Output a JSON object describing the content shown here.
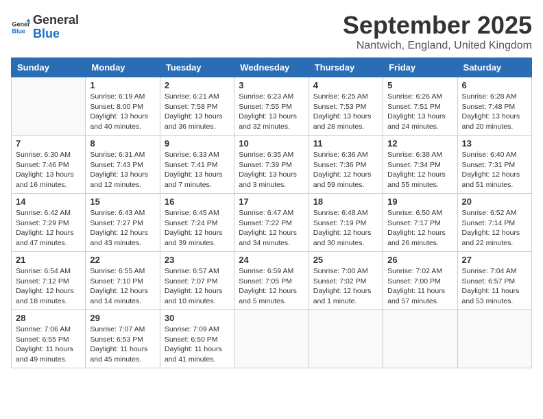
{
  "header": {
    "logo_general": "General",
    "logo_blue": "Blue",
    "month_title": "September 2025",
    "location": "Nantwich, England, United Kingdom"
  },
  "weekdays": [
    "Sunday",
    "Monday",
    "Tuesday",
    "Wednesday",
    "Thursday",
    "Friday",
    "Saturday"
  ],
  "weeks": [
    [
      {
        "day": "",
        "info": ""
      },
      {
        "day": "1",
        "info": "Sunrise: 6:19 AM\nSunset: 8:00 PM\nDaylight: 13 hours\nand 40 minutes."
      },
      {
        "day": "2",
        "info": "Sunrise: 6:21 AM\nSunset: 7:58 PM\nDaylight: 13 hours\nand 36 minutes."
      },
      {
        "day": "3",
        "info": "Sunrise: 6:23 AM\nSunset: 7:55 PM\nDaylight: 13 hours\nand 32 minutes."
      },
      {
        "day": "4",
        "info": "Sunrise: 6:25 AM\nSunset: 7:53 PM\nDaylight: 13 hours\nand 28 minutes."
      },
      {
        "day": "5",
        "info": "Sunrise: 6:26 AM\nSunset: 7:51 PM\nDaylight: 13 hours\nand 24 minutes."
      },
      {
        "day": "6",
        "info": "Sunrise: 6:28 AM\nSunset: 7:48 PM\nDaylight: 13 hours\nand 20 minutes."
      }
    ],
    [
      {
        "day": "7",
        "info": "Sunrise: 6:30 AM\nSunset: 7:46 PM\nDaylight: 13 hours\nand 16 minutes."
      },
      {
        "day": "8",
        "info": "Sunrise: 6:31 AM\nSunset: 7:43 PM\nDaylight: 13 hours\nand 12 minutes."
      },
      {
        "day": "9",
        "info": "Sunrise: 6:33 AM\nSunset: 7:41 PM\nDaylight: 13 hours\nand 7 minutes."
      },
      {
        "day": "10",
        "info": "Sunrise: 6:35 AM\nSunset: 7:39 PM\nDaylight: 13 hours\nand 3 minutes."
      },
      {
        "day": "11",
        "info": "Sunrise: 6:36 AM\nSunset: 7:36 PM\nDaylight: 12 hours\nand 59 minutes."
      },
      {
        "day": "12",
        "info": "Sunrise: 6:38 AM\nSunset: 7:34 PM\nDaylight: 12 hours\nand 55 minutes."
      },
      {
        "day": "13",
        "info": "Sunrise: 6:40 AM\nSunset: 7:31 PM\nDaylight: 12 hours\nand 51 minutes."
      }
    ],
    [
      {
        "day": "14",
        "info": "Sunrise: 6:42 AM\nSunset: 7:29 PM\nDaylight: 12 hours\nand 47 minutes."
      },
      {
        "day": "15",
        "info": "Sunrise: 6:43 AM\nSunset: 7:27 PM\nDaylight: 12 hours\nand 43 minutes."
      },
      {
        "day": "16",
        "info": "Sunrise: 6:45 AM\nSunset: 7:24 PM\nDaylight: 12 hours\nand 39 minutes."
      },
      {
        "day": "17",
        "info": "Sunrise: 6:47 AM\nSunset: 7:22 PM\nDaylight: 12 hours\nand 34 minutes."
      },
      {
        "day": "18",
        "info": "Sunrise: 6:48 AM\nSunset: 7:19 PM\nDaylight: 12 hours\nand 30 minutes."
      },
      {
        "day": "19",
        "info": "Sunrise: 6:50 AM\nSunset: 7:17 PM\nDaylight: 12 hours\nand 26 minutes."
      },
      {
        "day": "20",
        "info": "Sunrise: 6:52 AM\nSunset: 7:14 PM\nDaylight: 12 hours\nand 22 minutes."
      }
    ],
    [
      {
        "day": "21",
        "info": "Sunrise: 6:54 AM\nSunset: 7:12 PM\nDaylight: 12 hours\nand 18 minutes."
      },
      {
        "day": "22",
        "info": "Sunrise: 6:55 AM\nSunset: 7:10 PM\nDaylight: 12 hours\nand 14 minutes."
      },
      {
        "day": "23",
        "info": "Sunrise: 6:57 AM\nSunset: 7:07 PM\nDaylight: 12 hours\nand 10 minutes."
      },
      {
        "day": "24",
        "info": "Sunrise: 6:59 AM\nSunset: 7:05 PM\nDaylight: 12 hours\nand 5 minutes."
      },
      {
        "day": "25",
        "info": "Sunrise: 7:00 AM\nSunset: 7:02 PM\nDaylight: 12 hours\nand 1 minute."
      },
      {
        "day": "26",
        "info": "Sunrise: 7:02 AM\nSunset: 7:00 PM\nDaylight: 11 hours\nand 57 minutes."
      },
      {
        "day": "27",
        "info": "Sunrise: 7:04 AM\nSunset: 6:57 PM\nDaylight: 11 hours\nand 53 minutes."
      }
    ],
    [
      {
        "day": "28",
        "info": "Sunrise: 7:06 AM\nSunset: 6:55 PM\nDaylight: 11 hours\nand 49 minutes."
      },
      {
        "day": "29",
        "info": "Sunrise: 7:07 AM\nSunset: 6:53 PM\nDaylight: 11 hours\nand 45 minutes."
      },
      {
        "day": "30",
        "info": "Sunrise: 7:09 AM\nSunset: 6:50 PM\nDaylight: 11 hours\nand 41 minutes."
      },
      {
        "day": "",
        "info": ""
      },
      {
        "day": "",
        "info": ""
      },
      {
        "day": "",
        "info": ""
      },
      {
        "day": "",
        "info": ""
      }
    ]
  ]
}
